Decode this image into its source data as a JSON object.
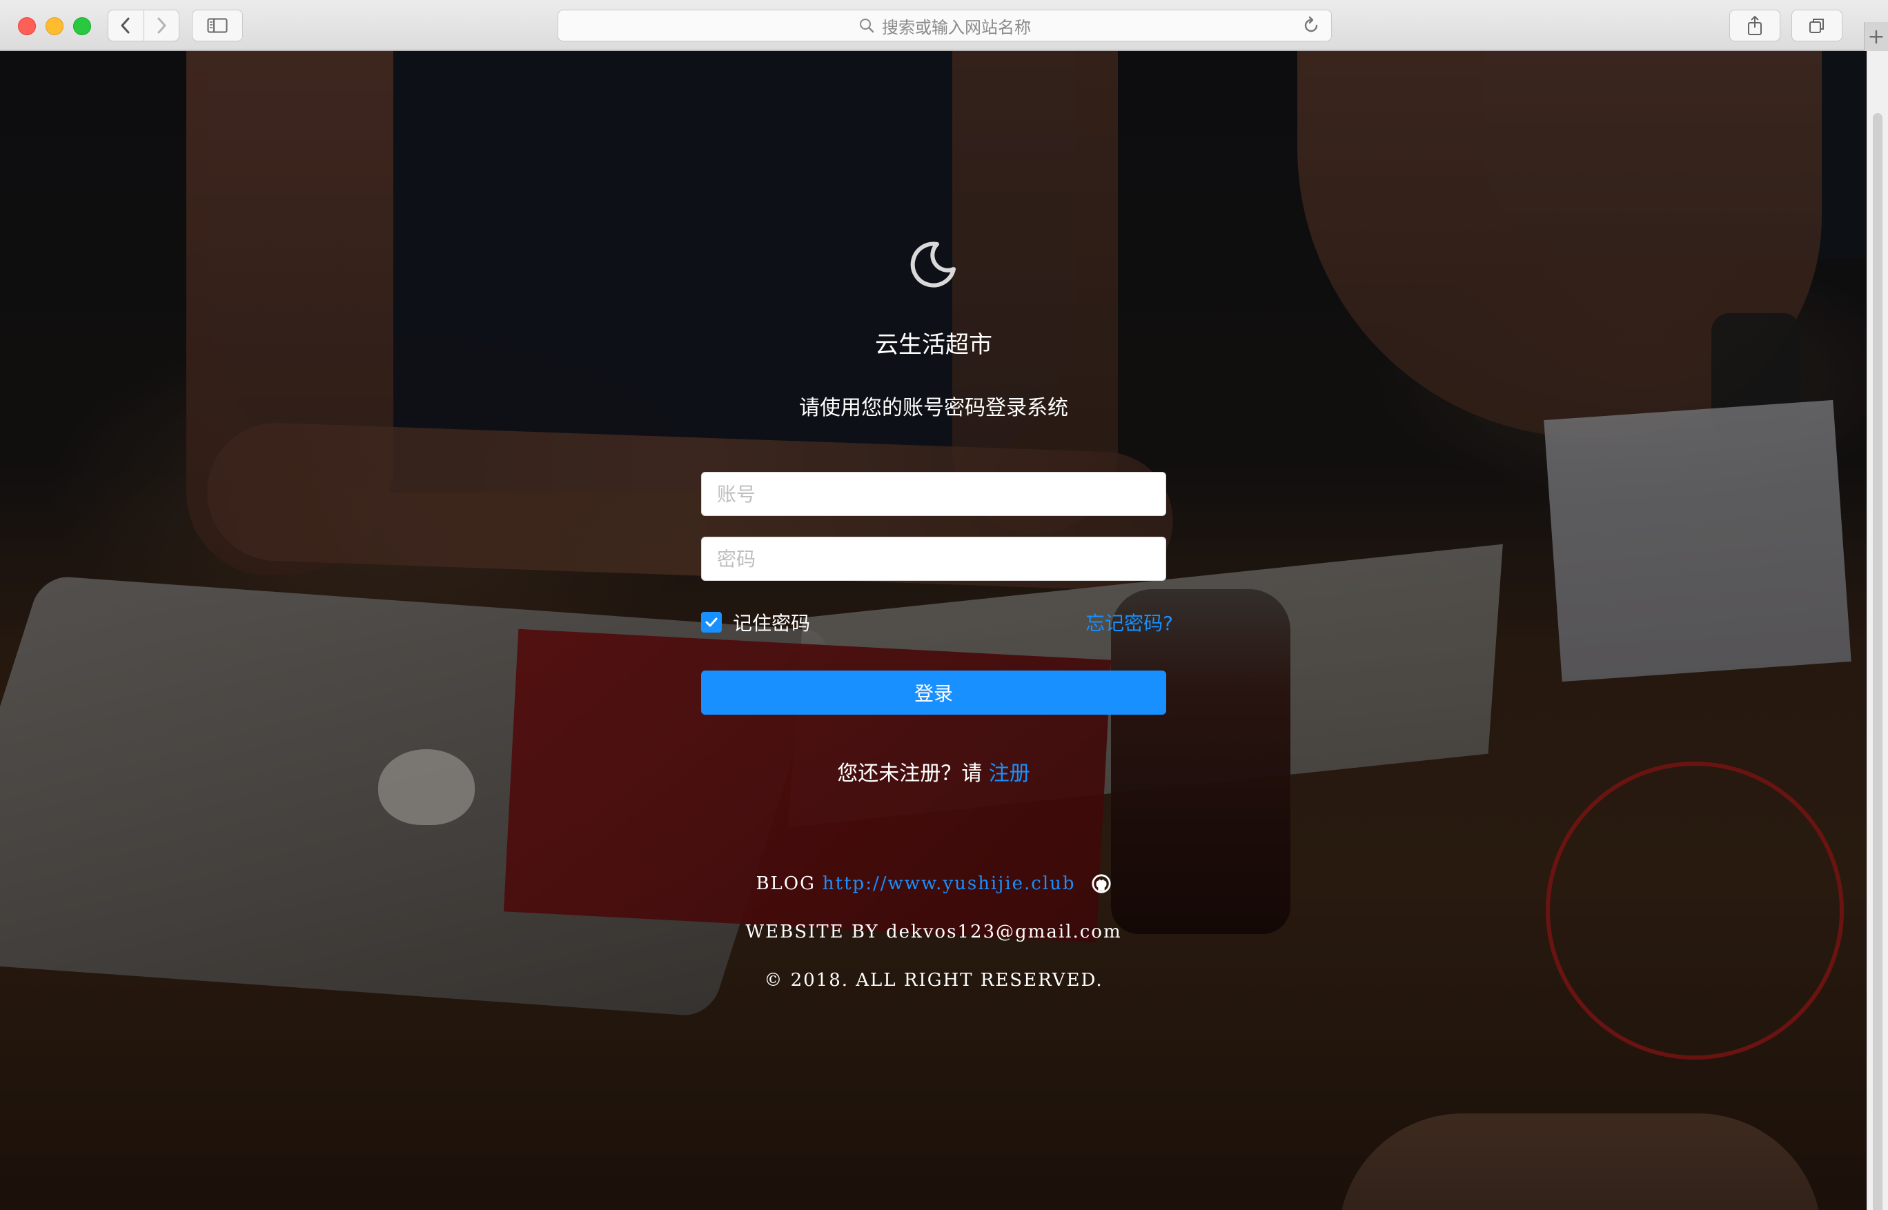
{
  "browser": {
    "address_placeholder": "搜索或输入网站名称",
    "icons": {
      "back": "chevron-left-icon",
      "forward": "chevron-right-icon",
      "sidebar": "sidebar-icon",
      "search": "search-icon",
      "reload": "reload-icon",
      "share": "share-icon",
      "tabs": "tabs-icon",
      "new_tab": "plus-icon"
    }
  },
  "login": {
    "site_title": "云生活超市",
    "subtitle": "请使用您的账号密码登录系统",
    "account_placeholder": "账号",
    "password_placeholder": "密码",
    "remember_label": "记住密码",
    "remember_checked": true,
    "forgot_label": "忘记密码?",
    "submit_label": "登录",
    "register_prompt": "您还未注册？请",
    "register_link": "注册"
  },
  "footer": {
    "blog_label": "BLOG",
    "blog_url": "http://www.yushijie.club",
    "website_by": "WEBSITE BY dekvos123@gmail.com",
    "copyright": "© 2018. ALL RIGHT RESERVED."
  },
  "colors": {
    "accent": "#1890ff",
    "text_light": "#ffffff",
    "close": "#fe5f57",
    "minimize": "#febc2e",
    "maximize": "#28c840"
  }
}
